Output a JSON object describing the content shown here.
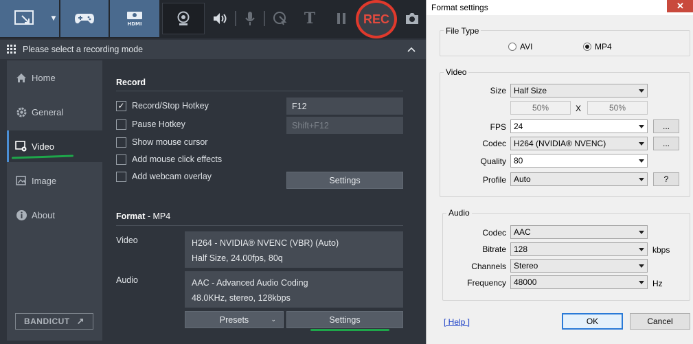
{
  "toolbar": {
    "rec_label": "REC",
    "hdmi_label": "HDMI"
  },
  "modebar": {
    "text": "Please select a recording mode"
  },
  "sidebar": {
    "items": [
      {
        "label": "Home",
        "icon": "home-icon"
      },
      {
        "label": "General",
        "icon": "gear-icon"
      },
      {
        "label": "Video",
        "icon": "video-settings-icon",
        "active": true
      },
      {
        "label": "Image",
        "icon": "image-icon"
      },
      {
        "label": "About",
        "icon": "info-icon"
      }
    ],
    "bandicut_label": "BANDICUT"
  },
  "record": {
    "title": "Record",
    "options": [
      {
        "label": "Record/Stop Hotkey",
        "checked": true
      },
      {
        "label": "Pause Hotkey",
        "checked": false
      },
      {
        "label": "Show mouse cursor",
        "checked": false
      },
      {
        "label": "Add mouse click effects",
        "checked": false
      },
      {
        "label": "Add webcam overlay",
        "checked": false
      }
    ],
    "hotkey_record": "F12",
    "hotkey_pause": "Shift+F12",
    "settings_label": "Settings"
  },
  "format": {
    "title": "Format",
    "title_sub": " - MP4",
    "video_label": "Video",
    "video_line1": "H264 - NVIDIA® NVENC (VBR) (Auto)",
    "video_line2": "Half Size, 24.00fps, 80q",
    "audio_label": "Audio",
    "audio_line1": "AAC - Advanced Audio Coding",
    "audio_line2": "48.0KHz, stereo, 128kbps",
    "presets_label": "Presets",
    "settings_label": "Settings"
  },
  "dialog": {
    "title": "Format settings",
    "close_glyph": "✕",
    "file_type": {
      "title": "File Type",
      "options": [
        {
          "label": "AVI",
          "selected": false
        },
        {
          "label": "MP4",
          "selected": true
        }
      ]
    },
    "video": {
      "title": "Video",
      "size_label": "Size",
      "size_value": "Half Size",
      "width_pct": "50%",
      "x_label": "X",
      "height_pct": "50%",
      "fps_label": "FPS",
      "fps_value": "24",
      "codec_label": "Codec",
      "codec_value": "H264 (NVIDIA® NVENC)",
      "quality_label": "Quality",
      "quality_value": "80",
      "profile_label": "Profile",
      "profile_value": "Auto",
      "more_label": "...",
      "help_q": "?"
    },
    "audio": {
      "title": "Audio",
      "codec_label": "Codec",
      "codec_value": "AAC",
      "bitrate_label": "Bitrate",
      "bitrate_value": "128",
      "bitrate_unit": "kbps",
      "channels_label": "Channels",
      "channels_value": "Stereo",
      "frequency_label": "Frequency",
      "frequency_value": "48000",
      "frequency_unit": "Hz"
    },
    "help_link": "[ Help ]",
    "ok_label": "OK",
    "cancel_label": "Cancel"
  },
  "colors": {
    "accent_blue": "#4a6a8e",
    "rec_red": "#e0392c",
    "annotation_green": "#1ea64a",
    "default_button_border": "#2a7ad7"
  }
}
